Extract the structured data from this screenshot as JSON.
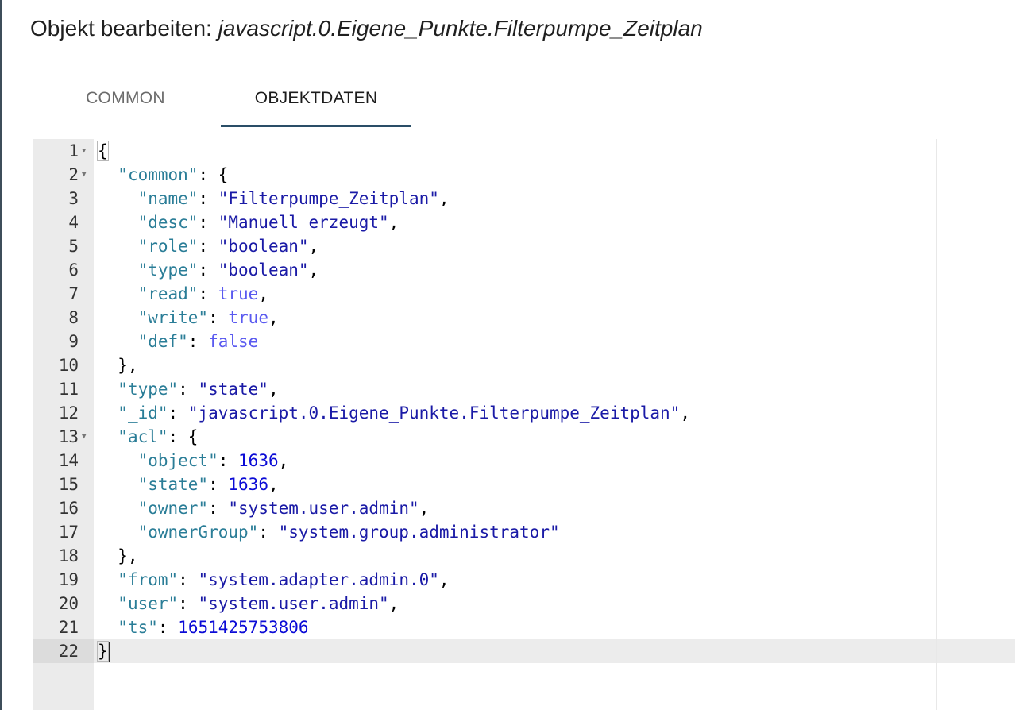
{
  "dialog": {
    "title_prefix": "Objekt bearbeiten:",
    "title_object": "javascript.0.Eigene_Punkte.Filterpumpe_Zeitplan"
  },
  "tabs": [
    {
      "label": "COMMON",
      "active": false
    },
    {
      "label": "OBJEKTDATEN",
      "active": true
    }
  ],
  "colors": {
    "accent": "#2a4e67",
    "json_key": "#2a7d97",
    "json_string": "#1a1aa6",
    "json_number": "#0b0bd6",
    "json_boolean": "#5a5af0"
  },
  "editor": {
    "active_line": 22,
    "lines": [
      {
        "n": "1",
        "fold": true,
        "tokens": [
          [
            "punc",
            "{"
          ]
        ]
      },
      {
        "n": "2",
        "fold": true,
        "tokens": [
          [
            "punc",
            "  "
          ],
          [
            "key",
            "\"common\""
          ],
          [
            "punc",
            ": {"
          ]
        ]
      },
      {
        "n": "3",
        "fold": false,
        "tokens": [
          [
            "punc",
            "    "
          ],
          [
            "key",
            "\"name\""
          ],
          [
            "punc",
            ": "
          ],
          [
            "str",
            "\"Filterpumpe_Zeitplan\""
          ],
          [
            "punc",
            ","
          ]
        ]
      },
      {
        "n": "4",
        "fold": false,
        "tokens": [
          [
            "punc",
            "    "
          ],
          [
            "key",
            "\"desc\""
          ],
          [
            "punc",
            ": "
          ],
          [
            "str",
            "\"Manuell erzeugt\""
          ],
          [
            "punc",
            ","
          ]
        ]
      },
      {
        "n": "5",
        "fold": false,
        "tokens": [
          [
            "punc",
            "    "
          ],
          [
            "key",
            "\"role\""
          ],
          [
            "punc",
            ": "
          ],
          [
            "str",
            "\"boolean\""
          ],
          [
            "punc",
            ","
          ]
        ]
      },
      {
        "n": "6",
        "fold": false,
        "tokens": [
          [
            "punc",
            "    "
          ],
          [
            "key",
            "\"type\""
          ],
          [
            "punc",
            ": "
          ],
          [
            "str",
            "\"boolean\""
          ],
          [
            "punc",
            ","
          ]
        ]
      },
      {
        "n": "7",
        "fold": false,
        "tokens": [
          [
            "punc",
            "    "
          ],
          [
            "key",
            "\"read\""
          ],
          [
            "punc",
            ": "
          ],
          [
            "bool",
            "true"
          ],
          [
            "punc",
            ","
          ]
        ]
      },
      {
        "n": "8",
        "fold": false,
        "tokens": [
          [
            "punc",
            "    "
          ],
          [
            "key",
            "\"write\""
          ],
          [
            "punc",
            ": "
          ],
          [
            "bool",
            "true"
          ],
          [
            "punc",
            ","
          ]
        ]
      },
      {
        "n": "9",
        "fold": false,
        "tokens": [
          [
            "punc",
            "    "
          ],
          [
            "key",
            "\"def\""
          ],
          [
            "punc",
            ": "
          ],
          [
            "bool",
            "false"
          ]
        ]
      },
      {
        "n": "10",
        "fold": false,
        "tokens": [
          [
            "punc",
            "  },"
          ]
        ]
      },
      {
        "n": "11",
        "fold": false,
        "tokens": [
          [
            "punc",
            "  "
          ],
          [
            "key",
            "\"type\""
          ],
          [
            "punc",
            ": "
          ],
          [
            "str",
            "\"state\""
          ],
          [
            "punc",
            ","
          ]
        ]
      },
      {
        "n": "12",
        "fold": false,
        "tokens": [
          [
            "punc",
            "  "
          ],
          [
            "key",
            "\"_id\""
          ],
          [
            "punc",
            ": "
          ],
          [
            "str",
            "\"javascript.0.Eigene_Punkte.Filterpumpe_Zeitplan\""
          ],
          [
            "punc",
            ","
          ]
        ]
      },
      {
        "n": "13",
        "fold": true,
        "tokens": [
          [
            "punc",
            "  "
          ],
          [
            "key",
            "\"acl\""
          ],
          [
            "punc",
            ": {"
          ]
        ]
      },
      {
        "n": "14",
        "fold": false,
        "tokens": [
          [
            "punc",
            "    "
          ],
          [
            "key",
            "\"object\""
          ],
          [
            "punc",
            ": "
          ],
          [
            "num",
            "1636"
          ],
          [
            "punc",
            ","
          ]
        ]
      },
      {
        "n": "15",
        "fold": false,
        "tokens": [
          [
            "punc",
            "    "
          ],
          [
            "key",
            "\"state\""
          ],
          [
            "punc",
            ": "
          ],
          [
            "num",
            "1636"
          ],
          [
            "punc",
            ","
          ]
        ]
      },
      {
        "n": "16",
        "fold": false,
        "tokens": [
          [
            "punc",
            "    "
          ],
          [
            "key",
            "\"owner\""
          ],
          [
            "punc",
            ": "
          ],
          [
            "str",
            "\"system.user.admin\""
          ],
          [
            "punc",
            ","
          ]
        ]
      },
      {
        "n": "17",
        "fold": false,
        "tokens": [
          [
            "punc",
            "    "
          ],
          [
            "key",
            "\"ownerGroup\""
          ],
          [
            "punc",
            ": "
          ],
          [
            "str",
            "\"system.group.administrator\""
          ]
        ]
      },
      {
        "n": "18",
        "fold": false,
        "tokens": [
          [
            "punc",
            "  },"
          ]
        ]
      },
      {
        "n": "19",
        "fold": false,
        "tokens": [
          [
            "punc",
            "  "
          ],
          [
            "key",
            "\"from\""
          ],
          [
            "punc",
            ": "
          ],
          [
            "str",
            "\"system.adapter.admin.0\""
          ],
          [
            "punc",
            ","
          ]
        ]
      },
      {
        "n": "20",
        "fold": false,
        "tokens": [
          [
            "punc",
            "  "
          ],
          [
            "key",
            "\"user\""
          ],
          [
            "punc",
            ": "
          ],
          [
            "str",
            "\"system.user.admin\""
          ],
          [
            "punc",
            ","
          ]
        ]
      },
      {
        "n": "21",
        "fold": false,
        "tokens": [
          [
            "punc",
            "  "
          ],
          [
            "key",
            "\"ts\""
          ],
          [
            "punc",
            ": "
          ],
          [
            "num",
            "1651425753806"
          ]
        ]
      },
      {
        "n": "22",
        "fold": false,
        "tokens": [
          [
            "punc",
            "}"
          ]
        ]
      }
    ]
  }
}
